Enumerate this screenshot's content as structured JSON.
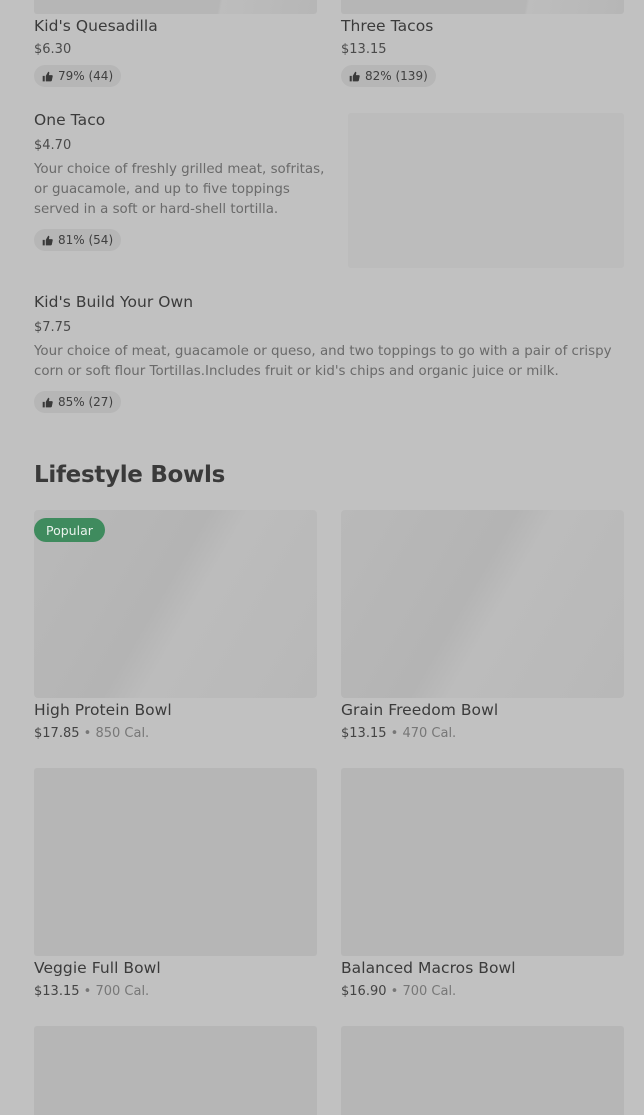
{
  "top_items": [
    {
      "name": "Kid's Quesadilla",
      "price": "$6.30",
      "rating": "79% (44)"
    },
    {
      "name": "Three Tacos",
      "price": "$13.15",
      "rating": "82% (139)"
    }
  ],
  "list_items": [
    {
      "name": "One Taco",
      "price": "$4.70",
      "description": "Your choice of freshly grilled meat, sofritas, or guacamole, and up to five toppings served in a soft or hard-shell tortilla.",
      "rating": "81% (54)"
    },
    {
      "name": "Kid's Build Your Own",
      "price": "$7.75",
      "description": "Your choice of meat, guacamole or queso, and two toppings to go with a pair of crispy corn or soft flour Tortillas.Includes fruit or kid's chips and organic juice or milk.",
      "rating": "85% (27)"
    }
  ],
  "section": {
    "title": "Lifestyle Bowls"
  },
  "bowls": [
    {
      "name": "High Protein Bowl",
      "price": "$17.85",
      "calories": "850 Cal.",
      "badge": "Popular"
    },
    {
      "name": "Grain Freedom Bowl",
      "price": "$13.15",
      "calories": "470 Cal."
    },
    {
      "name": "Veggie Full Bowl",
      "price": "$13.15",
      "calories": "700 Cal."
    },
    {
      "name": "Balanced Macros Bowl",
      "price": "$16.90",
      "calories": "700 Cal."
    }
  ],
  "separator": "•",
  "icons": {
    "rating": "thumbs-up-icon"
  },
  "colors": {
    "popular_badge": "#3f8b5e",
    "overlay_background": "#c1c1c1"
  }
}
